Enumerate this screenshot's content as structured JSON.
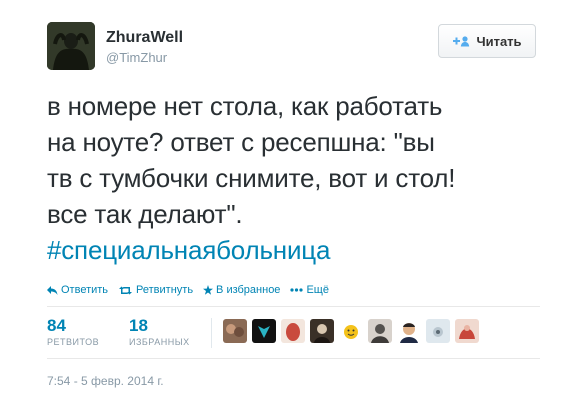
{
  "user": {
    "fullname": "ZhuraWell",
    "screenname": "@TimZhur"
  },
  "follow_button": {
    "label": "Читать",
    "icon": "follow-plus-icon"
  },
  "tweet": {
    "lines": [
      "в номере нет стола, как работать",
      "на ноуте? ответ с ресепшна: \"вы",
      "тв с тумбочки снимите, вот и стол!",
      "все так делают\"."
    ],
    "hashtag": "#специальнаябольница"
  },
  "actions": [
    {
      "label": "Ответить",
      "icon": "reply-icon"
    },
    {
      "label": "Ретвитнуть",
      "icon": "retweet-icon"
    },
    {
      "label": "В избранное",
      "icon": "star-icon"
    },
    {
      "label": "Ещё",
      "icon": "more-dots-icon"
    }
  ],
  "stats": {
    "retweets": {
      "count": "84",
      "label": "РЕТВИТОВ"
    },
    "favorites": {
      "count": "18",
      "label": "ИЗБРАННЫХ"
    }
  },
  "favoriter_avatars": [
    {
      "name": "avatar-1",
      "color": "#8a6a55"
    },
    {
      "name": "avatar-2",
      "color": "#1d2b33"
    },
    {
      "name": "avatar-3",
      "color": "#c94a3d"
    },
    {
      "name": "avatar-4",
      "color": "#3a3027"
    },
    {
      "name": "avatar-5",
      "color": "#f4c21a"
    },
    {
      "name": "avatar-6",
      "color": "#55524f"
    },
    {
      "name": "avatar-7",
      "color": "#2a2422"
    },
    {
      "name": "avatar-8",
      "color": "#b9c6cf"
    },
    {
      "name": "avatar-9",
      "color": "#c8463a"
    }
  ],
  "timestamp": "7:54 - 5 февр. 2014 г.",
  "colors": {
    "link": "#0084b4",
    "text": "#292f33",
    "muted": "#8899a6"
  }
}
